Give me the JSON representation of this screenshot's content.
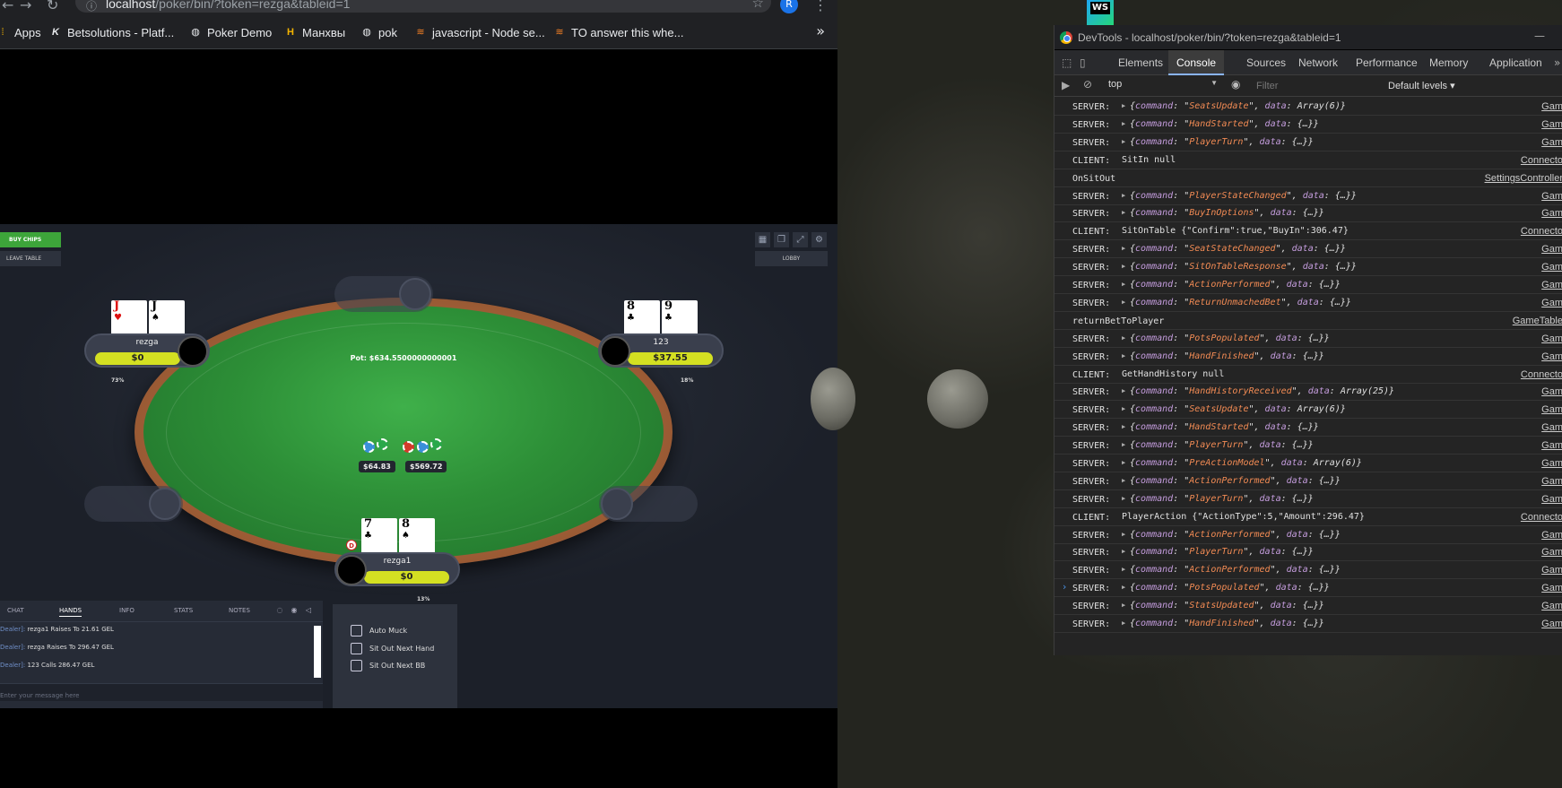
{
  "browser": {
    "url_host": "localhost",
    "url_path": "/poker/bin/?token=rezga&tableid=1",
    "profile_initial": "R",
    "bookmarks": [
      {
        "label": "Apps",
        "icon": "apps-grid-icon"
      },
      {
        "label": "Betsolutions - Platf...",
        "icon": "k-logo-icon"
      },
      {
        "label": "Poker Demo",
        "icon": "globe-icon"
      },
      {
        "label": "Манхвы",
        "icon": "h-logo-icon"
      },
      {
        "label": "pok",
        "icon": "globe-icon"
      },
      {
        "label": "javascript - Node se...",
        "icon": "stackoverflow-icon"
      },
      {
        "label": "TO answer this whe...",
        "icon": "stackoverflow-icon"
      }
    ]
  },
  "game": {
    "buy_chips": "BUY CHIPS",
    "leave_table": "LEAVE TABLE",
    "lobby": "LOBBY",
    "pot": "Pot: $634.5500000000001",
    "bets": [
      "$64.83",
      "$569.72"
    ],
    "dealer_label": "D",
    "players": [
      {
        "name": "rezga",
        "stack": "$0",
        "pct": "73%",
        "cards": [
          {
            "rank": "J",
            "suit": "♥",
            "color": "red"
          },
          {
            "rank": "J",
            "suit": "♠",
            "color": "black"
          }
        ]
      },
      {
        "name": "123",
        "stack": "$37.55",
        "pct": "18%",
        "cards": [
          {
            "rank": "8",
            "suit": "♣",
            "color": "black"
          },
          {
            "rank": "9",
            "suit": "♣",
            "color": "black"
          }
        ]
      },
      {
        "name": "rezga1",
        "stack": "$0",
        "pct": "13%",
        "cards": [
          {
            "rank": "7",
            "suit": "♣",
            "color": "black"
          },
          {
            "rank": "8",
            "suit": "♠",
            "color": "black"
          }
        ]
      }
    ],
    "chat": {
      "tabs": [
        "CHAT",
        "HANDS",
        "INFO",
        "STATS",
        "NOTES"
      ],
      "active_tab": "HANDS",
      "lines": [
        {
          "who": "Dealer]:",
          "text": " rezga1 Raises To 21.61 GEL"
        },
        {
          "who": "Dealer]:",
          "text": " rezga Raises To 296.47 GEL"
        },
        {
          "who": "Dealer]:",
          "text": " 123 Calls 286.47 GEL"
        }
      ],
      "placeholder": "Enter your message here"
    },
    "options": [
      "Auto Muck",
      "Sit Out Next Hand",
      "Sit Out Next BB"
    ]
  },
  "devtools": {
    "title": "DevTools - localhost/poker/bin/?token=rezga&tableid=1",
    "tabs": [
      "Elements",
      "Console",
      "Sources",
      "Network",
      "Performance",
      "Memory",
      "Application"
    ],
    "active_tab": "Console",
    "context": "top",
    "filter_placeholder": "Filter",
    "levels": "Default levels",
    "rows": [
      {
        "tag": "SERVER:",
        "cmd": "SeatsUpdate",
        "data": "Array(6)",
        "src": "Gam"
      },
      {
        "tag": "SERVER:",
        "cmd": "HandStarted",
        "data": "{…}",
        "src": "Gam"
      },
      {
        "tag": "SERVER:",
        "cmd": "PlayerTurn",
        "data": "{…}",
        "src": "Gam"
      },
      {
        "tag": "CLIENT:",
        "msg": "SitIn null",
        "src": "Connecto"
      },
      {
        "tag": "OnSitOut",
        "msg": "",
        "src": "SettingsController"
      },
      {
        "tag": "SERVER:",
        "cmd": "PlayerStateChanged",
        "data": "{…}",
        "src": "Gam"
      },
      {
        "tag": "SERVER:",
        "cmd": "BuyInOptions",
        "data": "{…}",
        "src": "Gam"
      },
      {
        "tag": "CLIENT:",
        "msg": "SitOnTable {\"Confirm\":true,\"BuyIn\":306.47}",
        "src": "Connecto"
      },
      {
        "tag": "SERVER:",
        "cmd": "SeatStateChanged",
        "data": "{…}",
        "src": "Gam"
      },
      {
        "tag": "SERVER:",
        "cmd": "SitOnTableResponse",
        "data": "{…}",
        "src": "Gam"
      },
      {
        "tag": "SERVER:",
        "cmd": "ActionPerformed",
        "data": "{…}",
        "src": "Gam"
      },
      {
        "tag": "SERVER:",
        "cmd": "ReturnUnmachedBet",
        "data": "{…}",
        "src": "Gam"
      },
      {
        "tag": "returnBetToPlayer",
        "msg": "",
        "src": "GameTable"
      },
      {
        "tag": "SERVER:",
        "cmd": "PotsPopulated",
        "data": "{…}",
        "src": "Gam"
      },
      {
        "tag": "SERVER:",
        "cmd": "HandFinished",
        "data": "{…}",
        "src": "Gam"
      },
      {
        "tag": "CLIENT:",
        "msg": "GetHandHistory null",
        "src": "Connecto"
      },
      {
        "tag": "SERVER:",
        "cmd": "HandHistoryReceived",
        "data": "Array(25)",
        "src": "Gam"
      },
      {
        "tag": "SERVER:",
        "cmd": "SeatsUpdate",
        "data": "Array(6)",
        "src": "Gam"
      },
      {
        "tag": "SERVER:",
        "cmd": "HandStarted",
        "data": "{…}",
        "src": "Gam"
      },
      {
        "tag": "SERVER:",
        "cmd": "PlayerTurn",
        "data": "{…}",
        "src": "Gam"
      },
      {
        "tag": "SERVER:",
        "cmd": "PreActionModel",
        "data": "Array(6)",
        "src": "Gam"
      },
      {
        "tag": "SERVER:",
        "cmd": "ActionPerformed",
        "data": "{…}",
        "src": "Gam"
      },
      {
        "tag": "SERVER:",
        "cmd": "PlayerTurn",
        "data": "{…}",
        "src": "Gam"
      },
      {
        "tag": "CLIENT:",
        "msg": "PlayerAction {\"ActionType\":5,\"Amount\":296.47}",
        "src": "Connecto"
      },
      {
        "tag": "SERVER:",
        "cmd": "ActionPerformed",
        "data": "{…}",
        "src": "Gam"
      },
      {
        "tag": "SERVER:",
        "cmd": "PlayerTurn",
        "data": "{…}",
        "src": "Gam"
      },
      {
        "tag": "SERVER:",
        "cmd": "ActionPerformed",
        "data": "{…}",
        "src": "Gam"
      },
      {
        "tag": "SERVER:",
        "cmd": "PotsPopulated",
        "data": "{…}",
        "src": "Gam"
      },
      {
        "tag": "SERVER:",
        "cmd": "StatsUpdated",
        "data": "{…}",
        "src": "Gam"
      },
      {
        "tag": "SERVER:",
        "cmd": "HandFinished",
        "data": "{…}",
        "src": "Gam"
      }
    ]
  }
}
